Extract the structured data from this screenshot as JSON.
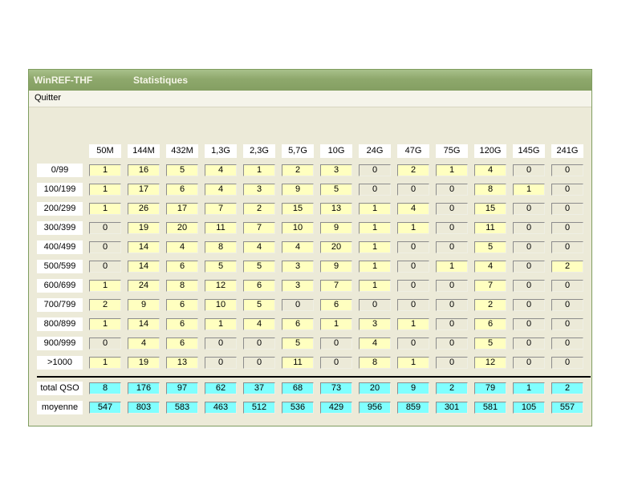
{
  "window": {
    "app_title": "WinREF-THF",
    "subtitle": "Statistiques",
    "menu": [
      "Quitter"
    ]
  },
  "table": {
    "bands": [
      "50M",
      "144M",
      "432M",
      "1,3G",
      "2,3G",
      "5,7G",
      "10G",
      "24G",
      "47G",
      "75G",
      "120G",
      "145G",
      "241G"
    ],
    "row_labels": [
      "0/99",
      "100/199",
      "200/299",
      "300/399",
      "400/499",
      "500/599",
      "600/699",
      "700/799",
      "800/899",
      "900/999",
      ">1000"
    ],
    "rows": [
      [
        "1",
        "16",
        "5",
        "4",
        "1",
        "2",
        "3",
        "0",
        "2",
        "1",
        "4",
        "0",
        "0"
      ],
      [
        "1",
        "17",
        "6",
        "4",
        "3",
        "9",
        "5",
        "0",
        "0",
        "0",
        "8",
        "1",
        "0"
      ],
      [
        "1",
        "26",
        "17",
        "7",
        "2",
        "15",
        "13",
        "1",
        "4",
        "0",
        "15",
        "0",
        "0"
      ],
      [
        "0",
        "19",
        "20",
        "11",
        "7",
        "10",
        "9",
        "1",
        "1",
        "0",
        "11",
        "0",
        "0"
      ],
      [
        "0",
        "14",
        "4",
        "8",
        "4",
        "4",
        "20",
        "1",
        "0",
        "0",
        "5",
        "0",
        "0"
      ],
      [
        "0",
        "14",
        "6",
        "5",
        "5",
        "3",
        "9",
        "1",
        "0",
        "1",
        "4",
        "0",
        "2"
      ],
      [
        "1",
        "24",
        "8",
        "12",
        "6",
        "3",
        "7",
        "1",
        "0",
        "0",
        "7",
        "0",
        "0"
      ],
      [
        "2",
        "9",
        "6",
        "10",
        "5",
        "0",
        "6",
        "0",
        "0",
        "0",
        "2",
        "0",
        "0"
      ],
      [
        "1",
        "14",
        "6",
        "1",
        "4",
        "6",
        "1",
        "3",
        "1",
        "0",
        "6",
        "0",
        "0"
      ],
      [
        "0",
        "4",
        "6",
        "0",
        "0",
        "5",
        "0",
        "4",
        "0",
        "0",
        "5",
        "0",
        "0"
      ],
      [
        "1",
        "19",
        "13",
        "0",
        "0",
        "11",
        "0",
        "8",
        "1",
        "0",
        "12",
        "0",
        "0"
      ]
    ]
  },
  "summary": {
    "total_label": "total QSO",
    "total": [
      "8",
      "176",
      "97",
      "62",
      "37",
      "68",
      "73",
      "20",
      "9",
      "2",
      "79",
      "1",
      "2"
    ],
    "average_label": "moyenne",
    "average": [
      "547",
      "803",
      "583",
      "463",
      "512",
      "536",
      "429",
      "956",
      "859",
      "301",
      "581",
      "105",
      "557"
    ]
  }
}
